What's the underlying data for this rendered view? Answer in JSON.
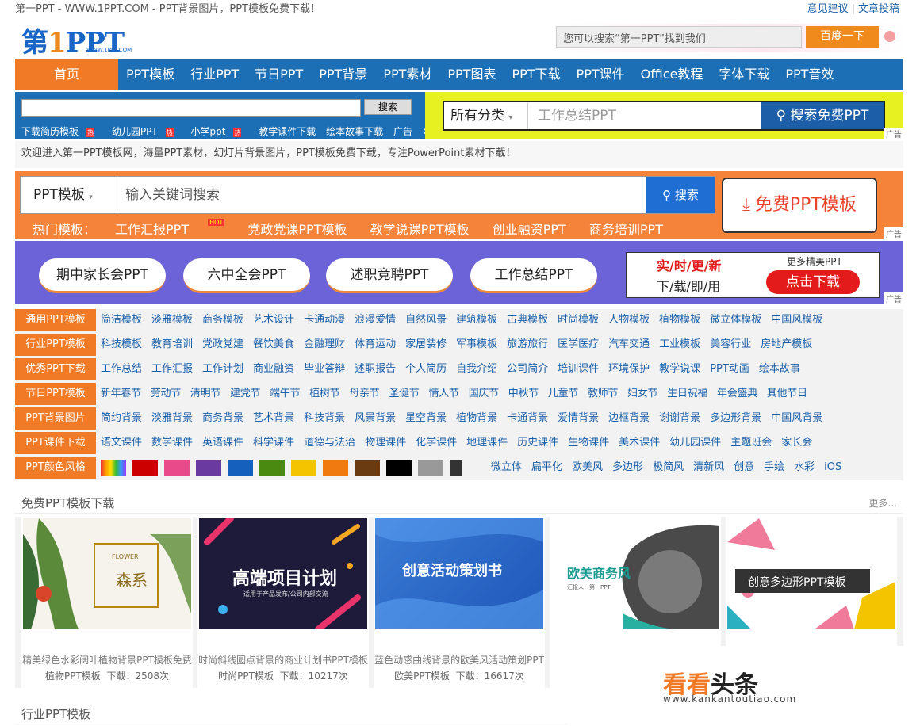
{
  "topbar": {
    "title": "第一PPT - WWW.1PPT.COM - PPT背景图片，PPT模板免费下载！",
    "feedback": "意见建议",
    "sep": "|",
    "post": "文章投稿"
  },
  "header": {
    "logo": "第1PPT",
    "logo_one": "1",
    "logo_first": "第",
    "logo_ppt": "PPT",
    "logo_url": "WWW.1PPT.COM",
    "search_placeholder": "您可以搜索“第一PPT”找到我们",
    "search_button": "百度一下"
  },
  "nav": {
    "home": "首页",
    "items": [
      "PPT模板",
      "行业PPT",
      "节日PPT",
      "PPT背景",
      "PPT素材",
      "PPT图表",
      "PPT下载",
      "PPT课件",
      "Office教程",
      "字体下载",
      "PPT音效"
    ]
  },
  "ad_left": {
    "search_button": "搜索",
    "links": [
      "下载简历模板",
      "幼儿园PPT",
      "小学ppt",
      "教学课件下载",
      "绘本故事下载"
    ],
    "hot_badge": "热",
    "ad_label": "广告",
    "close": "✕"
  },
  "ad_right": {
    "category": "所有分类",
    "keyword": "工作总结PPT",
    "button": "搜索免费PPT",
    "ad_label": "广告"
  },
  "welcome": "欢迎进入第一PPT模板网，海量PPT素材，幻灯片背景图片，PPT模板免费下载，专注PowerPoint素材下载！",
  "orange": {
    "category": "PPT模板",
    "placeholder": "输入关键词搜索",
    "button": "搜索",
    "hot_label": "热门模板：",
    "hot_items": [
      "工作汇报PPT",
      "党政党课PPT模板",
      "教学说课PPT模板",
      "创业融资PPT",
      "商务培训PPT"
    ],
    "hot_badge": "HOT",
    "free_button": "免费PPT模板",
    "ad_label": "广告"
  },
  "pills": {
    "items": [
      "期中家长会PPT",
      "六中全会PPT",
      "述职竞聘PPT",
      "工作总结PPT"
    ],
    "ad_line1": "实/时/更/新",
    "ad_line2": "下/载/即/用",
    "ad_more": "更多精美PPT",
    "ad_button": "点击下载",
    "ad_label": "广告"
  },
  "categories": [
    {
      "label": "通用PPT模板",
      "items": [
        "简洁模板",
        "淡雅模板",
        "商务模板",
        "艺术设计",
        "卡通动漫",
        "浪漫爱情",
        "自然风景",
        "建筑模板",
        "古典模板",
        "时尚模板",
        "人物模板",
        "植物模板",
        "微立体模板",
        "中国风模板"
      ]
    },
    {
      "label": "行业PPT模板",
      "items": [
        "科技模板",
        "教育培训",
        "党政党建",
        "餐饮美食",
        "金融理财",
        "体育运动",
        "家居装修",
        "军事模板",
        "旅游旅行",
        "医学医疗",
        "汽车交通",
        "工业模板",
        "美容行业",
        "房地产模板"
      ]
    },
    {
      "label": "优秀PPT下载",
      "items": [
        "工作总结",
        "工作汇报",
        "工作计划",
        "商业融资",
        "毕业答辩",
        "述职报告",
        "个人简历",
        "自我介绍",
        "公司简介",
        "培训课件",
        "环境保护",
        "教学说课",
        "PPT动画",
        "绘本故事"
      ]
    },
    {
      "label": "节日PPT模板",
      "items": [
        "新年春节",
        "劳动节",
        "清明节",
        "建党节",
        "端午节",
        "植树节",
        "母亲节",
        "圣诞节",
        "情人节",
        "国庆节",
        "中秋节",
        "儿童节",
        "教师节",
        "妇女节",
        "生日祝福",
        "年会盛典",
        "其他节日"
      ]
    },
    {
      "label": "PPT背景图片",
      "items": [
        "简约背景",
        "淡雅背景",
        "商务背景",
        "艺术背景",
        "科技背景",
        "风景背景",
        "星空背景",
        "植物背景",
        "卡通背景",
        "爱情背景",
        "边框背景",
        "谢谢背景",
        "多边形背景",
        "中国风背景"
      ]
    },
    {
      "label": "PPT课件下载",
      "items": [
        "语文课件",
        "数学课件",
        "英语课件",
        "科学课件",
        "道德与法治",
        "物理课件",
        "化学课件",
        "地理课件",
        "历史课件",
        "生物课件",
        "美术课件",
        "幼儿园课件",
        "主题班会",
        "家长会"
      ]
    },
    {
      "label": "PPT颜色风格",
      "styles": [
        "微立体",
        "扁平化",
        "欧美风",
        "多边形",
        "极简风",
        "清新风",
        "创意",
        "手绘",
        "水彩",
        "iOS"
      ],
      "swatches": [
        "rainbow",
        "#cc0000",
        "#e84a8a",
        "#6a3aa0",
        "#1560bd",
        "#4a8a10",
        "#f5c400",
        "#f07a10",
        "#6a3a10",
        "#000000",
        "#999999",
        "#333333"
      ]
    }
  ],
  "free_section": {
    "title": "免费PPT模板下载",
    "more": "更多..."
  },
  "cards": [
    {
      "title": "精美绿色水彩阔叶植物背景PPT模板免费",
      "category": "植物PPT模板",
      "downloads": "下载：2508次",
      "img_text": "森系",
      "img_sub": "FLOWER"
    },
    {
      "title": "时尚斜线圆点背景的商业计划书PPT模板",
      "category": "时尚PPT模板",
      "downloads": "下载：10217次",
      "img_text": "高端项目计划",
      "img_sub": "适用于产品发布/公司内部交流"
    },
    {
      "title": "蓝色动感曲线背景的欧美风活动策划PPT",
      "category": "欧美PPT模板",
      "downloads": "下载：16617次",
      "img_text": "创意活动策划书"
    },
    {
      "title": "",
      "category": "",
      "downloads": "",
      "img_text": "欧美商务风",
      "img_sub": "汇报人：第一PPT"
    },
    {
      "title": "",
      "category": "",
      "downloads": "",
      "img_text": "创意多边形PPT模板"
    }
  ],
  "industry_section": {
    "title": "行业PPT模板"
  },
  "watermark": {
    "main": "看看",
    "main2": "头条",
    "url": "www.kankantoutiao.com"
  }
}
